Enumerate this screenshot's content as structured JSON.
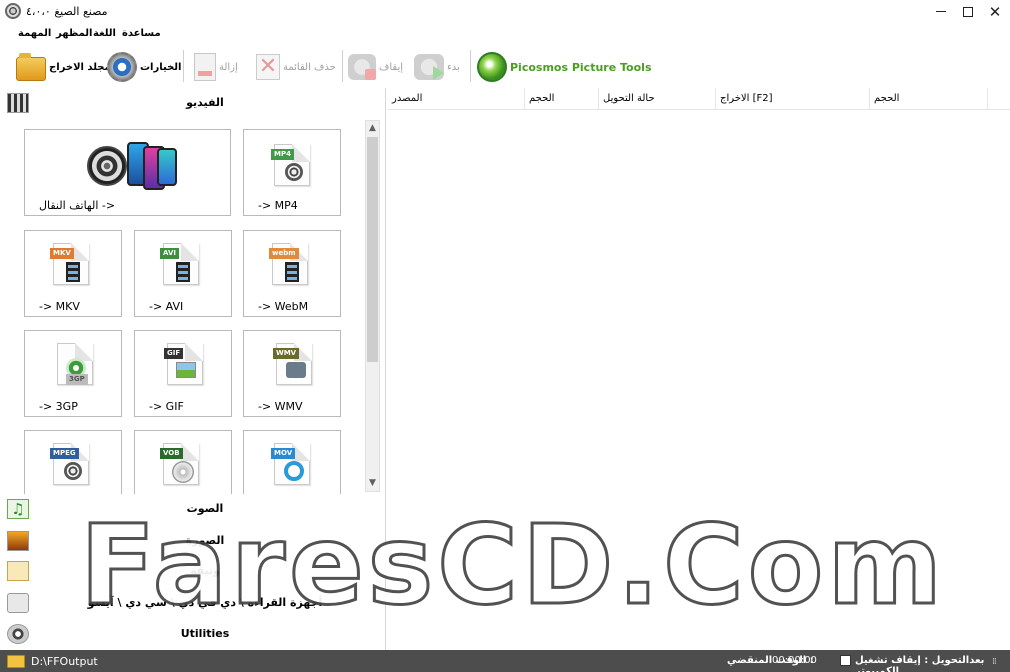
{
  "window": {
    "title": "مصنع الصيغ ٤،٠،٠",
    "min_glyph": "",
    "max_glyph": "",
    "close_glyph": "✕"
  },
  "menu": [
    "المهمة",
    "المظهر",
    "اللغة",
    "مساعدة"
  ],
  "toolbar": {
    "output_folder": "مجلد الاخراج",
    "options": "الخيارات",
    "remove": "إزالة",
    "clear_list": "حذف القائمة",
    "stop": "إيقاف",
    "start": "بدء",
    "picosmos": "Picosmos Picture Tools"
  },
  "categories": {
    "video": "الفيديو",
    "audio": "الصوت",
    "picture": "الصورة",
    "document": "وثيقة",
    "rom": "أجهزة القراءة \\ دي في دي \\ سي دي \\ آيسو",
    "utilities": "Utilities"
  },
  "formats": [
    {
      "label": "الهاتف النقال ->",
      "tag": ""
    },
    {
      "label": "-> MP4",
      "tag": "MP4",
      "color": "#3f9b4a"
    },
    {
      "label": "-> MKV",
      "tag": "MKV",
      "color": "#e07a2f"
    },
    {
      "label": "-> AVI",
      "tag": "AVI",
      "color": "#3c8f3c"
    },
    {
      "label": "-> WebM",
      "tag": "webm",
      "color": "#e08a3a"
    },
    {
      "label": "-> 3GP",
      "tag": "3GP",
      "color": "#3a9e3a"
    },
    {
      "label": "-> GIF",
      "tag": "GIF",
      "color": "#333333"
    },
    {
      "label": "-> WMV",
      "tag": "WMV",
      "color": "#6a6a2a"
    },
    {
      "label": "",
      "tag": "MPEG",
      "color": "#2f5f9e"
    },
    {
      "label": "",
      "tag": "VOB",
      "color": "#2a6a2a"
    },
    {
      "label": "",
      "tag": "MOV",
      "color": "#2a8ad0"
    }
  ],
  "list_columns": [
    "المصدر",
    "الحجم",
    "حالة التحويل",
    "الاخراج [F2]",
    "الحجم"
  ],
  "status": {
    "output_path": "D:\\FFOutput",
    "elapsed_label": "الوقت المنقضي :",
    "elapsed_time": "00:00:00",
    "after_convert": "بعدالتحويل : إيقاف تشغيل الكمبيوتر",
    "grip": "⁞⁞"
  },
  "watermark": "FaresCD.Com",
  "colors": {
    "statusbar": "#4d4d4d",
    "picosmos_green": "#4a9e20",
    "disabled_text": "#a0a0a0"
  }
}
